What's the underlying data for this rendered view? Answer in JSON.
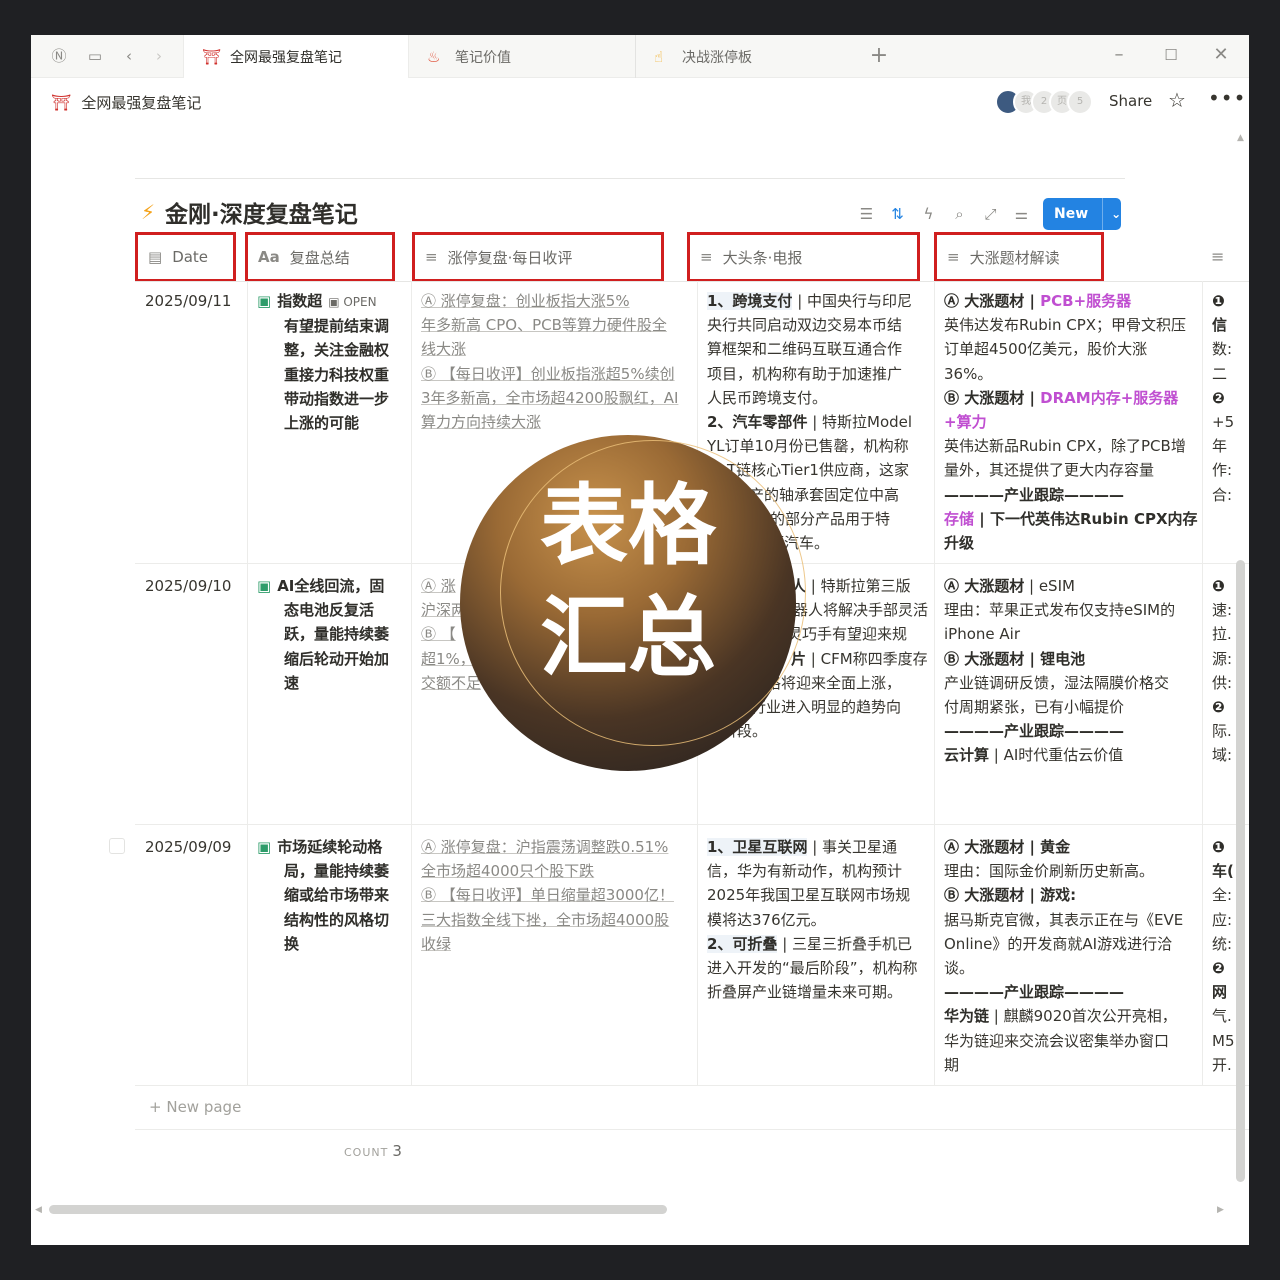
{
  "tabs": [
    {
      "icon": "⛩",
      "label": "全网最强复盘笔记",
      "active": true
    },
    {
      "icon": "♨",
      "label": "笔记价值",
      "active": false
    },
    {
      "icon": "☝",
      "label": "决战涨停板",
      "active": false
    }
  ],
  "breadcrumb": "全网最强复盘笔记",
  "header_actions": {
    "share": "Share"
  },
  "avatars": [
    "",
    "我",
    "2",
    "页",
    "5"
  ],
  "database": {
    "title": "金刚·深度复盘笔记",
    "new_button": "New",
    "columns": [
      "Date",
      "复盘总结",
      "涨停复盘·每日收评",
      "大头条·电报",
      "大涨题材解读"
    ],
    "new_page": "New page",
    "count_label": "COUNT",
    "count": "3"
  },
  "rows": [
    {
      "date": "2025/09/11",
      "summary_lines": [
        "指数超",
        "有望提前结束调",
        "整，关注金融权",
        "重接力科技权重",
        "带动指数进一步",
        "上涨的可能"
      ],
      "open": "OPEN",
      "review_lines": [
        "Ⓐ 涨停复盘：创业板指大涨5%",
        "年多新高 CPO、PCB等算力硬件股全",
        "线大涨",
        "Ⓑ 【每日收评】创业板指涨超5%续创",
        "3年多新高，全市场超4200股飘红，AI",
        "算力方向持续大涨"
      ],
      "news_lines": [
        {
          "b": "1、跨境支付",
          "t": " | 中国央行与印尼"
        },
        {
          "b": "",
          "t": "央行共同启动双边交易本币结"
        },
        {
          "b": "",
          "t": "算框架和二维码互联互通合作"
        },
        {
          "b": "",
          "t": "项目，机构称有助于加速推广"
        },
        {
          "b": "",
          "t": "人民币跨境支付。"
        },
        {
          "b": "2、汽车零部件",
          "t": " | 特斯拉Model"
        },
        {
          "b": "",
          "t": "YL订单10月份已售罄，机构称"
        },
        {
          "b": "",
          "t": "T链核心Tier1供应商，这家"
        },
        {
          "b": "",
          "t": "产的轴承套固定位中高"
        },
        {
          "b": "",
          "t": "司的部分产品用于特"
        },
        {
          "b": "",
          "t": "源汽车。"
        }
      ],
      "theme_lines": [
        {
          "b": "Ⓐ 大涨题材 | ",
          "p": "PCB+服务器",
          "t": ""
        },
        {
          "b": "",
          "p": "",
          "t": "英伟达发布Rubin CPX；甲骨文积压"
        },
        {
          "b": "",
          "p": "",
          "t": "订单超4500亿美元，股价大涨"
        },
        {
          "b": "",
          "p": "",
          "t": "36%。"
        },
        {
          "b": "Ⓑ 大涨题材 | ",
          "p": "DRAM内存+服务器",
          "t": ""
        },
        {
          "b": "",
          "p": "+算力",
          "t": ""
        },
        {
          "b": "",
          "p": "",
          "t": "英伟达新品Rubin CPX，除了PCB增"
        },
        {
          "b": "",
          "p": "",
          "t": "量外，其还提供了更大内存容量"
        },
        {
          "b": "————产业跟踪————",
          "p": "",
          "t": ""
        },
        {
          "b": "",
          "p": "存储",
          "t": " | 下一代英伟达Rubin CPX内存"
        },
        {
          "b": "升级",
          "p": "",
          "t": ""
        }
      ],
      "extra_lines": [
        "❶",
        "信",
        "数:",
        "二",
        "❷",
        "+5",
        "年",
        "作:",
        "合:"
      ]
    },
    {
      "date": "2025/09/10",
      "summary_lines": [
        "AI全线回流，固",
        "态电池反复活",
        "跃，量能持续萎",
        "缩后轮动开始加",
        "速"
      ],
      "review_lines": [
        "Ⓐ 涨",
        "沪深两",
        "Ⓑ 【",
        "超1%，",
        "交额不足"
      ],
      "news_lines": [
        {
          "b": "人",
          "t": " | 特斯拉第三版"
        },
        {
          "b": "",
          "t": "器人将解决手部灵活"
        },
        {
          "b": "",
          "t": "灵巧手有望迎来规"
        },
        {
          "b": "",
          "t": ""
        },
        {
          "b": "片",
          "t": " | CFM称四季度存"
        },
        {
          "b": "",
          "t": "价格将迎来全面上涨，"
        },
        {
          "b": "",
          "t": "构称行业进入明显的趋势向"
        },
        {
          "b": "",
          "t": "上阶段。"
        }
      ],
      "theme_lines": [
        {
          "b": "Ⓐ 大涨题材",
          "p": "",
          "t": " | eSIM"
        },
        {
          "b": "",
          "p": "",
          "t": "理由：苹果正式发布仅支持eSIM的"
        },
        {
          "b": "",
          "p": "",
          "t": "iPhone Air"
        },
        {
          "b": "Ⓑ 大涨题材 | 锂电池",
          "p": "",
          "t": ""
        },
        {
          "b": "",
          "p": "",
          "t": "产业链调研反馈，湿法隔膜价格交"
        },
        {
          "b": "",
          "p": "",
          "t": "付周期紧张，已有小幅提价"
        },
        {
          "b": "————产业跟踪————",
          "p": "",
          "t": ""
        },
        {
          "b": "云计算",
          "p": "",
          "t": " | AI时代重估云价值"
        }
      ],
      "extra_lines": [
        "❶",
        "速:",
        "拉.",
        "源:",
        "供:",
        "❷",
        "际.",
        "域:"
      ]
    },
    {
      "date": "2025/09/09",
      "summary_lines": [
        "市场延续轮动格",
        "局，量能持续萎",
        "缩或给市场带来",
        "结构性的风格切",
        "换"
      ],
      "review_lines": [
        "Ⓐ 涨停复盘：沪指震荡调整跌0.51%",
        "全市场超4000只个股下跌",
        "Ⓑ 【每日收评】单日缩量超3000亿！",
        "三大指数全线下挫，全市场超4000股",
        "收绿"
      ],
      "news_lines": [
        {
          "b": "1、卫星互联网",
          "t": " | 事关卫星通"
        },
        {
          "b": "",
          "t": "信，华为有新动作，机构预计"
        },
        {
          "b": "",
          "t": "2025年我国卫星互联网市场规"
        },
        {
          "b": "",
          "t": "模将达376亿元。"
        },
        {
          "b": "2、可折叠",
          "t": " | 三星三折叠手机已"
        },
        {
          "b": "",
          "t": "进入开发的“最后阶段”，机构称"
        },
        {
          "b": "",
          "t": "折叠屏产业链增量未来可期。"
        }
      ],
      "theme_lines": [
        {
          "b": "Ⓐ 大涨题材 | 黄金",
          "p": "",
          "t": ""
        },
        {
          "b": "",
          "p": "",
          "t": "理由：国际金价刷新历史新高。"
        },
        {
          "b": "Ⓑ 大涨题材 | 游戏:",
          "p": "",
          "t": ""
        },
        {
          "b": "",
          "p": "",
          "t": "据马斯克官微，其表示正在与《EVE"
        },
        {
          "b": "",
          "p": "",
          "t": "Online》的开发商就AI游戏进行洽"
        },
        {
          "b": "",
          "p": "",
          "t": "谈。"
        },
        {
          "b": "————产业跟踪————",
          "p": "",
          "t": ""
        },
        {
          "b": "华为链",
          "p": "",
          "t": " | 麒麟9020首次公开亮相，"
        },
        {
          "b": "",
          "p": "",
          "t": "华为链迎来交流会议密集举办窗口"
        },
        {
          "b": "",
          "p": "",
          "t": "期"
        }
      ],
      "extra_lines": [
        "❶",
        "车(",
        "全:",
        "应:",
        "统:",
        "❷",
        "网",
        "气.",
        "M5",
        "开."
      ]
    }
  ],
  "overlay": {
    "line1": "表格",
    "line2": "汇总"
  },
  "colors": {
    "header_box": "#d01f1f",
    "accent": "#2383e2",
    "pink_tag": "#c04fd1"
  }
}
